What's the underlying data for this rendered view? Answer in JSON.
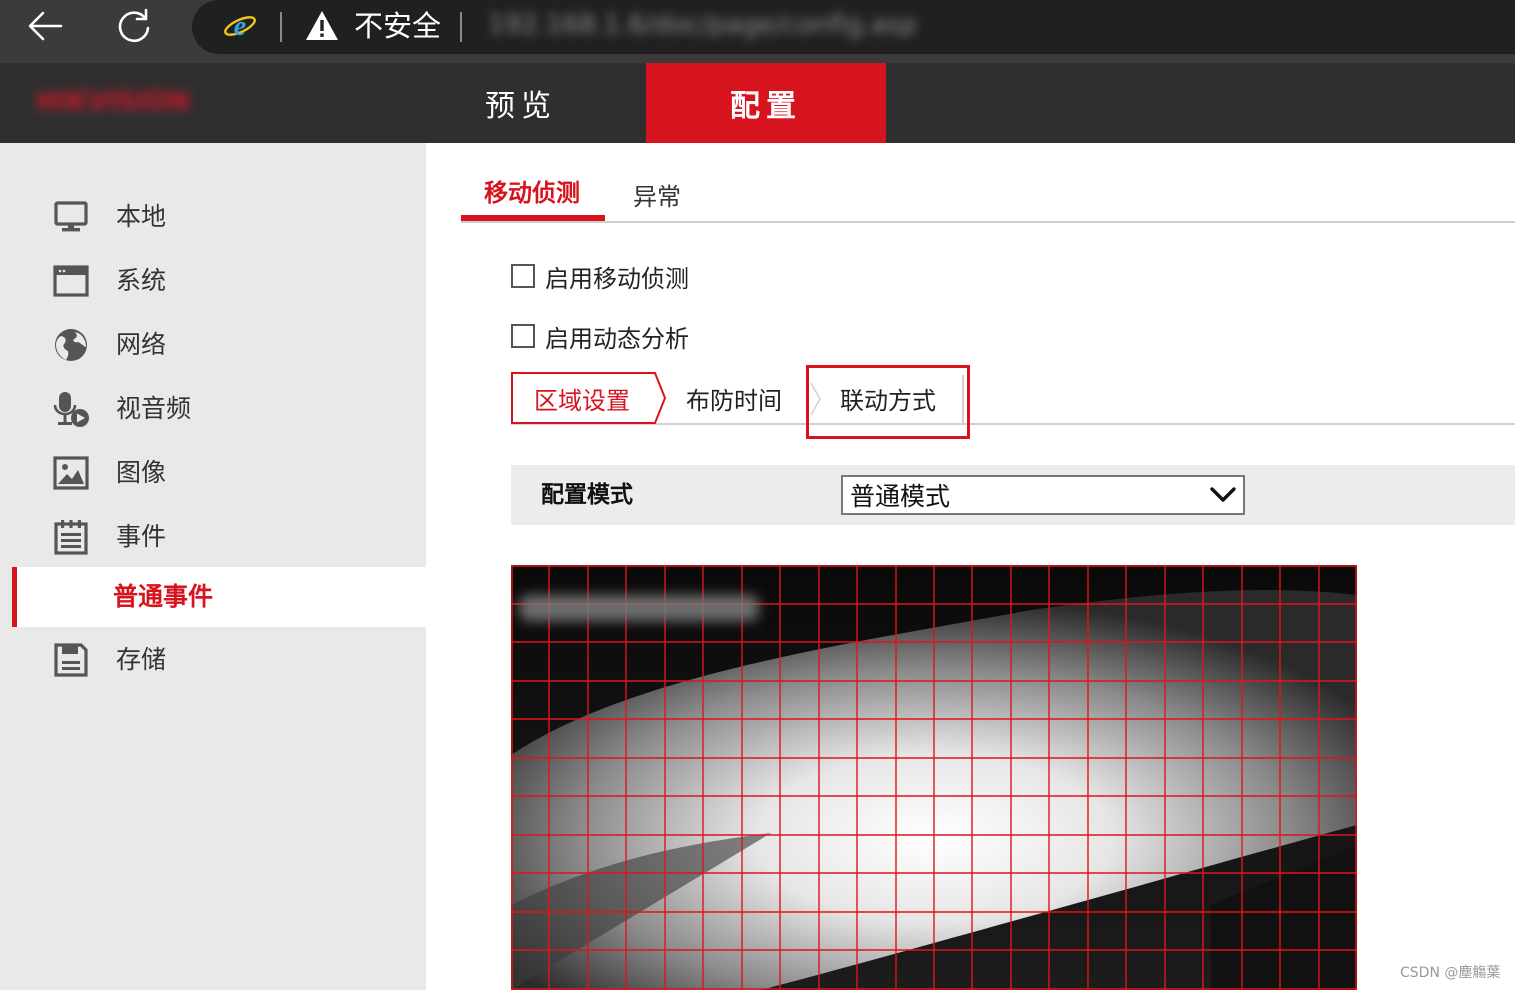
{
  "browser": {
    "back_icon": "arrow-left-icon",
    "refresh_icon": "refresh-icon",
    "browser_icon": "ie-logo-icon",
    "warning_icon": "warning-triangle-icon",
    "security_status": "不安全",
    "url": "192.168.1.6/doc/page/config.asp"
  },
  "app": {
    "brand_red": "HIKVISION",
    "brand_grey": "",
    "tabs": [
      {
        "label": "预览",
        "active": false
      },
      {
        "label": "配置",
        "active": true
      }
    ],
    "accent_color": "#d7141e"
  },
  "sidebar": {
    "items": [
      {
        "label": "本地",
        "icon": "monitor-icon"
      },
      {
        "label": "系统",
        "icon": "window-icon"
      },
      {
        "label": "网络",
        "icon": "globe-icon"
      },
      {
        "label": "视音频",
        "icon": "microphone-video-icon"
      },
      {
        "label": "图像",
        "icon": "image-icon"
      },
      {
        "label": "事件",
        "icon": "calendar-list-icon"
      },
      {
        "label": "存储",
        "icon": "floppy-disk-icon"
      }
    ],
    "active_sub_item": "普通事件"
  },
  "main": {
    "tabs": [
      {
        "label": "移动侦测",
        "active": true
      },
      {
        "label": "异常",
        "active": false
      }
    ],
    "checkboxes": [
      {
        "label": "启用移动侦测",
        "checked": false
      },
      {
        "label": "启用动态分析",
        "checked": false
      }
    ],
    "steps": [
      {
        "label": "区域设置",
        "active": true
      },
      {
        "label": "布防时间",
        "active": false
      },
      {
        "label": "联动方式",
        "active": false,
        "highlighted": true
      }
    ],
    "config_mode": {
      "label": "配置模式",
      "value": "普通模式"
    }
  },
  "watermark": "CSDN @塵觴葉"
}
